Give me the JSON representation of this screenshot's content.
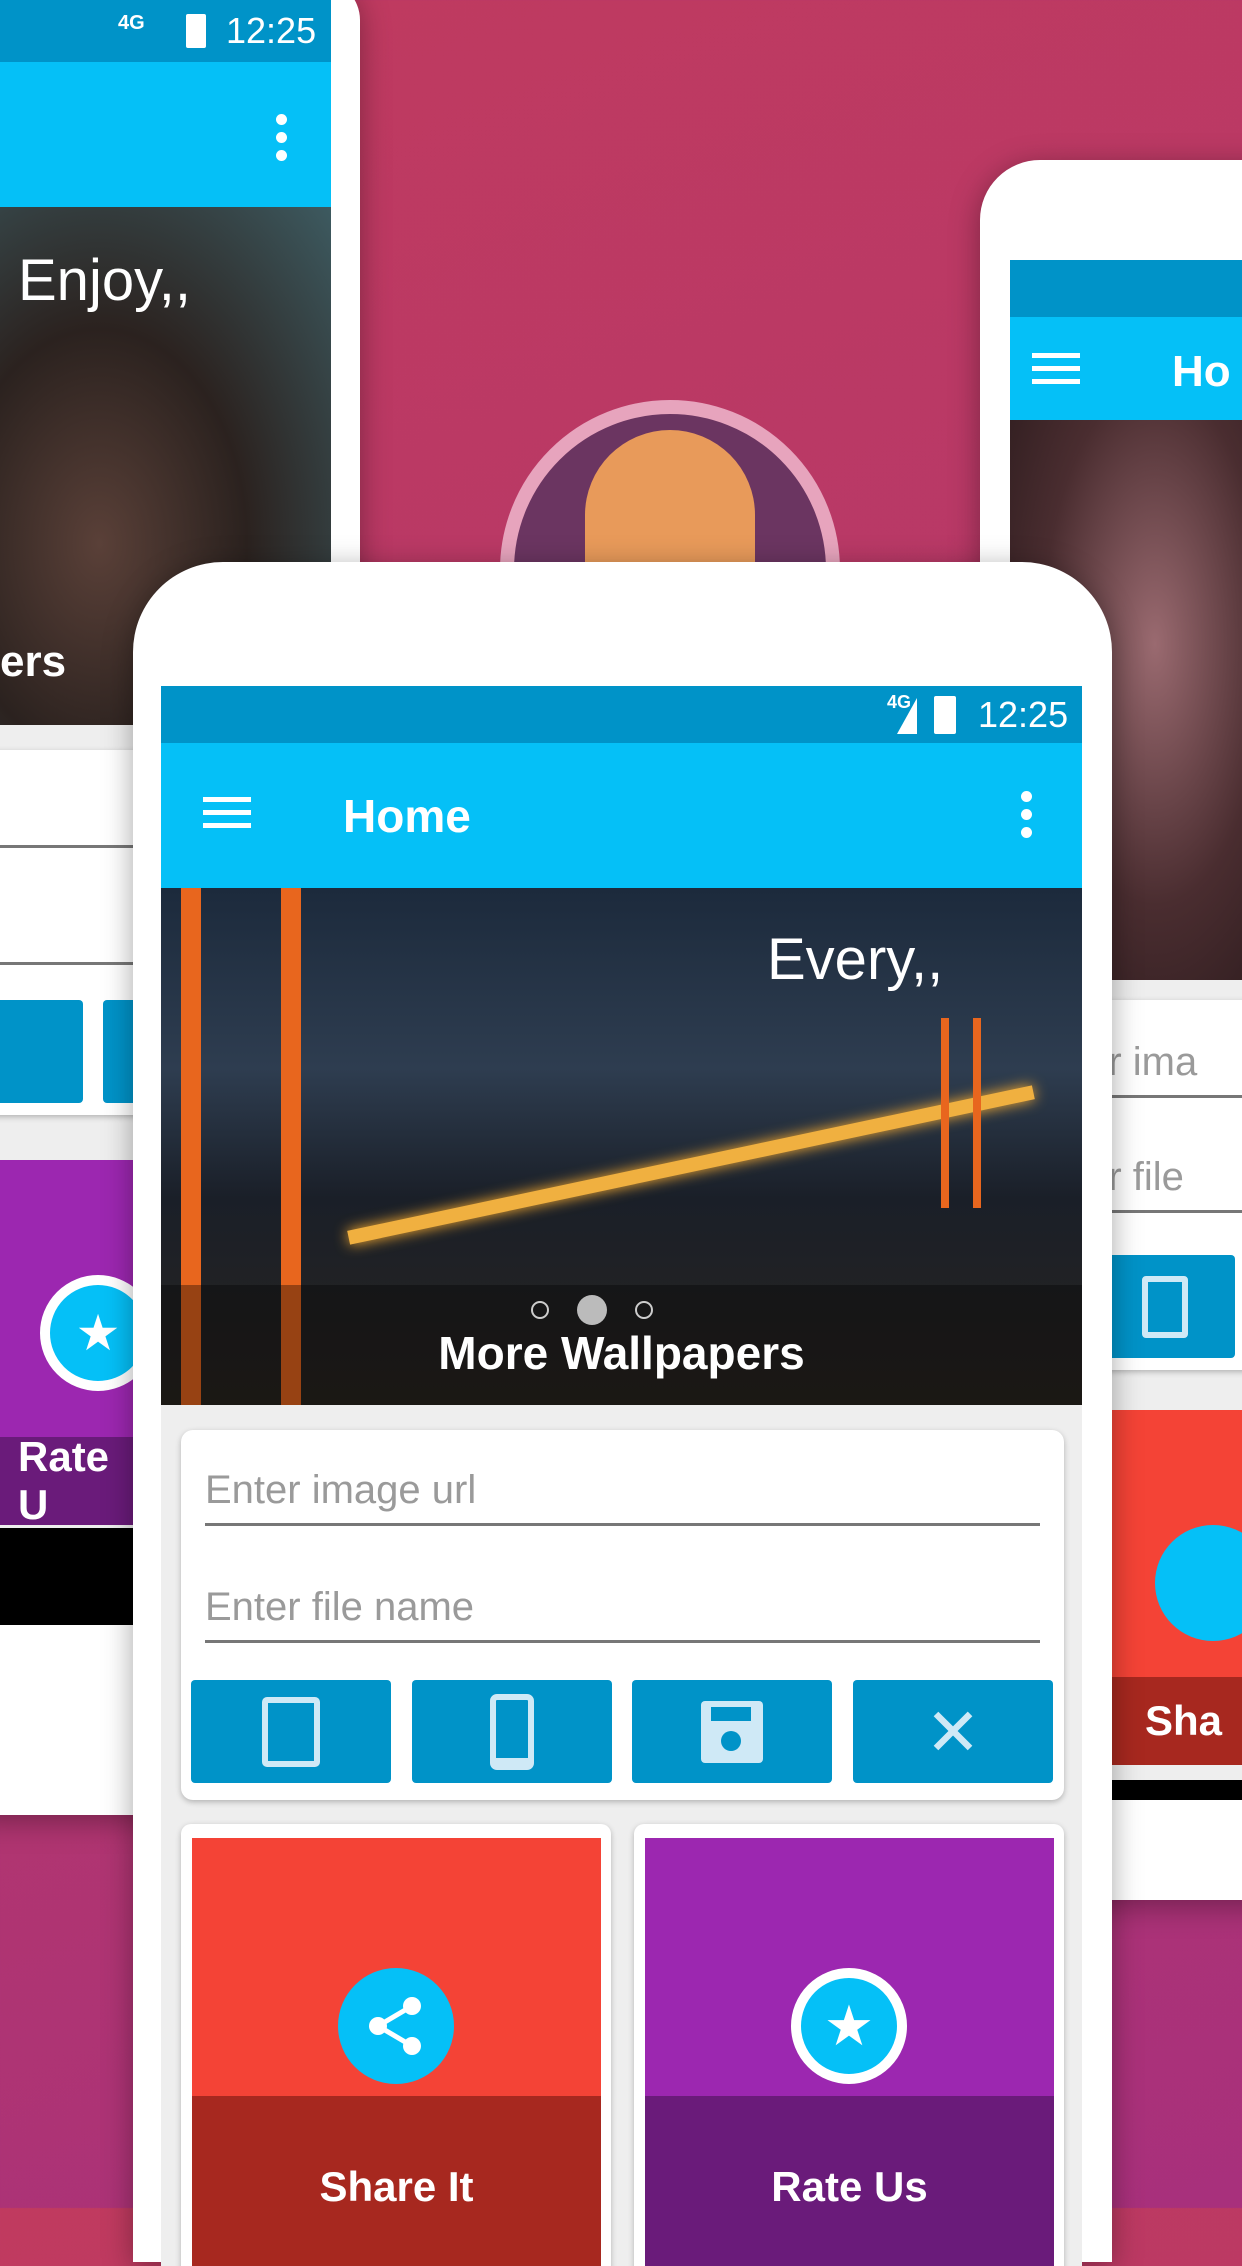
{
  "colors": {
    "status_bar": "#0093c8",
    "app_bar": "#05c0f7",
    "button": "#0093c8",
    "share_tile": "#f44336",
    "rate_tile": "#9c27b0",
    "background": "#c03a5f"
  },
  "left_phone": {
    "status": {
      "network": "4G",
      "time": "12:25"
    },
    "banner_text": "Enjoy,,",
    "banner_caption": "ers",
    "tile_label": "Rate U"
  },
  "right_phone": {
    "title": "Ho",
    "field1": "ter ima",
    "field2": "ter file",
    "tile_label": "Sha"
  },
  "main_phone": {
    "status": {
      "network": "4G",
      "time": "12:25"
    },
    "app_bar": {
      "title": "Home",
      "menu_icon": "hamburger-icon",
      "overflow_icon": "more-vert-icon"
    },
    "banner": {
      "overlay_text": "Every,,",
      "caption": "More Wallpapers",
      "pager": {
        "count": 3,
        "active": 2
      }
    },
    "form": {
      "url_placeholder": "Enter image url",
      "name_placeholder": "Enter file name",
      "buttons": [
        {
          "icon": "clipboard-icon"
        },
        {
          "icon": "phone-icon"
        },
        {
          "icon": "save-icon"
        },
        {
          "icon": "close-icon"
        }
      ]
    },
    "tiles": [
      {
        "label": "Share It",
        "icon": "share-icon"
      },
      {
        "label": "Rate Us",
        "icon": "star-icon"
      }
    ]
  }
}
